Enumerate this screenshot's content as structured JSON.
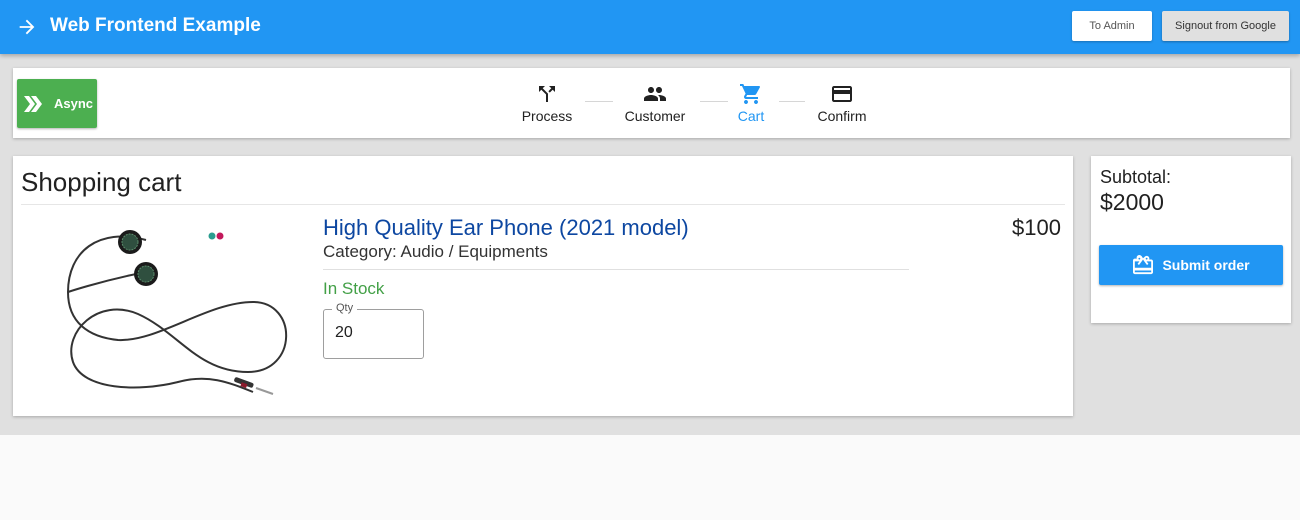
{
  "header": {
    "title": "Web Frontend Example",
    "admin_label": "To Admin",
    "signout_label": "Signout from Google"
  },
  "stepper": {
    "async_label": "Async",
    "steps": [
      {
        "label": "Process",
        "icon": "fork-icon"
      },
      {
        "label": "Customer",
        "icon": "people-icon"
      },
      {
        "label": "Cart",
        "icon": "cart-icon",
        "active": true
      },
      {
        "label": "Confirm",
        "icon": "credit-card-icon"
      }
    ]
  },
  "cart": {
    "title": "Shopping cart",
    "items": [
      {
        "name": "High Quality Ear Phone (2021 model)",
        "category": "Category: Audio / Equipments",
        "stock": "In Stock",
        "qty_label": "Qty",
        "qty": "20",
        "price": "$100"
      }
    ]
  },
  "summary": {
    "subtotal_label": "Subtotal:",
    "subtotal_value": "$2000",
    "submit_label": "Submit order"
  },
  "colors": {
    "primary": "#2196f3",
    "success": "#4caf50",
    "stock_text": "#43a047",
    "link": "#0d47a1"
  }
}
